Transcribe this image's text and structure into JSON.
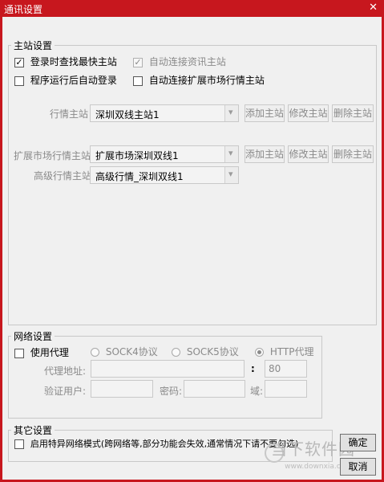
{
  "window": {
    "title": "通讯设置",
    "close_glyph": "✕"
  },
  "main_station": {
    "group_label": "主站设置",
    "options": [
      {
        "label": "登录时查找最快主站",
        "checked": true,
        "enabled": true
      },
      {
        "label": "自动连接资讯主站",
        "checked": true,
        "enabled": false
      },
      {
        "label": "程序运行后自动登录",
        "checked": false,
        "enabled": true
      },
      {
        "label": "自动连接扩展市场行情主站",
        "checked": false,
        "enabled": true
      }
    ],
    "rows": [
      {
        "label": "行情主站",
        "selected": "深圳双线主站1",
        "buttons": [
          "添加主站",
          "修改主站",
          "删除主站"
        ]
      },
      {
        "label": "扩展市场行情主站",
        "selected": "扩展市场深圳双线1",
        "buttons": [
          "添加主站",
          "修改主站",
          "删除主站"
        ]
      },
      {
        "label": "高级行情主站",
        "selected": "高级行情_深圳双线1",
        "buttons": []
      }
    ]
  },
  "network": {
    "group_label": "网络设置",
    "use_proxy_label": "使用代理",
    "use_proxy_checked": false,
    "protocols": [
      {
        "label": "SOCK4协议",
        "checked": false
      },
      {
        "label": "SOCK5协议",
        "checked": false
      },
      {
        "label": "HTTP代理",
        "checked": true
      }
    ],
    "proxy_address_label": "代理地址:",
    "proxy_address_value": "",
    "port_sep": ":",
    "port_value": "80",
    "auth_user_label": "验证用户:",
    "auth_user_value": "",
    "password_label": "密码:",
    "password_value": "",
    "domain_label": "域:",
    "domain_value": ""
  },
  "other": {
    "group_label": "其它设置",
    "special_mode_label": "启用特异网络模式(跨网络等,部分功能会失效,通常情况下请不要勾选)",
    "special_mode_checked": false
  },
  "actions": {
    "ok_label": "确定",
    "cancel_label": "取消"
  },
  "watermark": {
    "text": "当下软件园",
    "sub": "www.downxia.com"
  }
}
